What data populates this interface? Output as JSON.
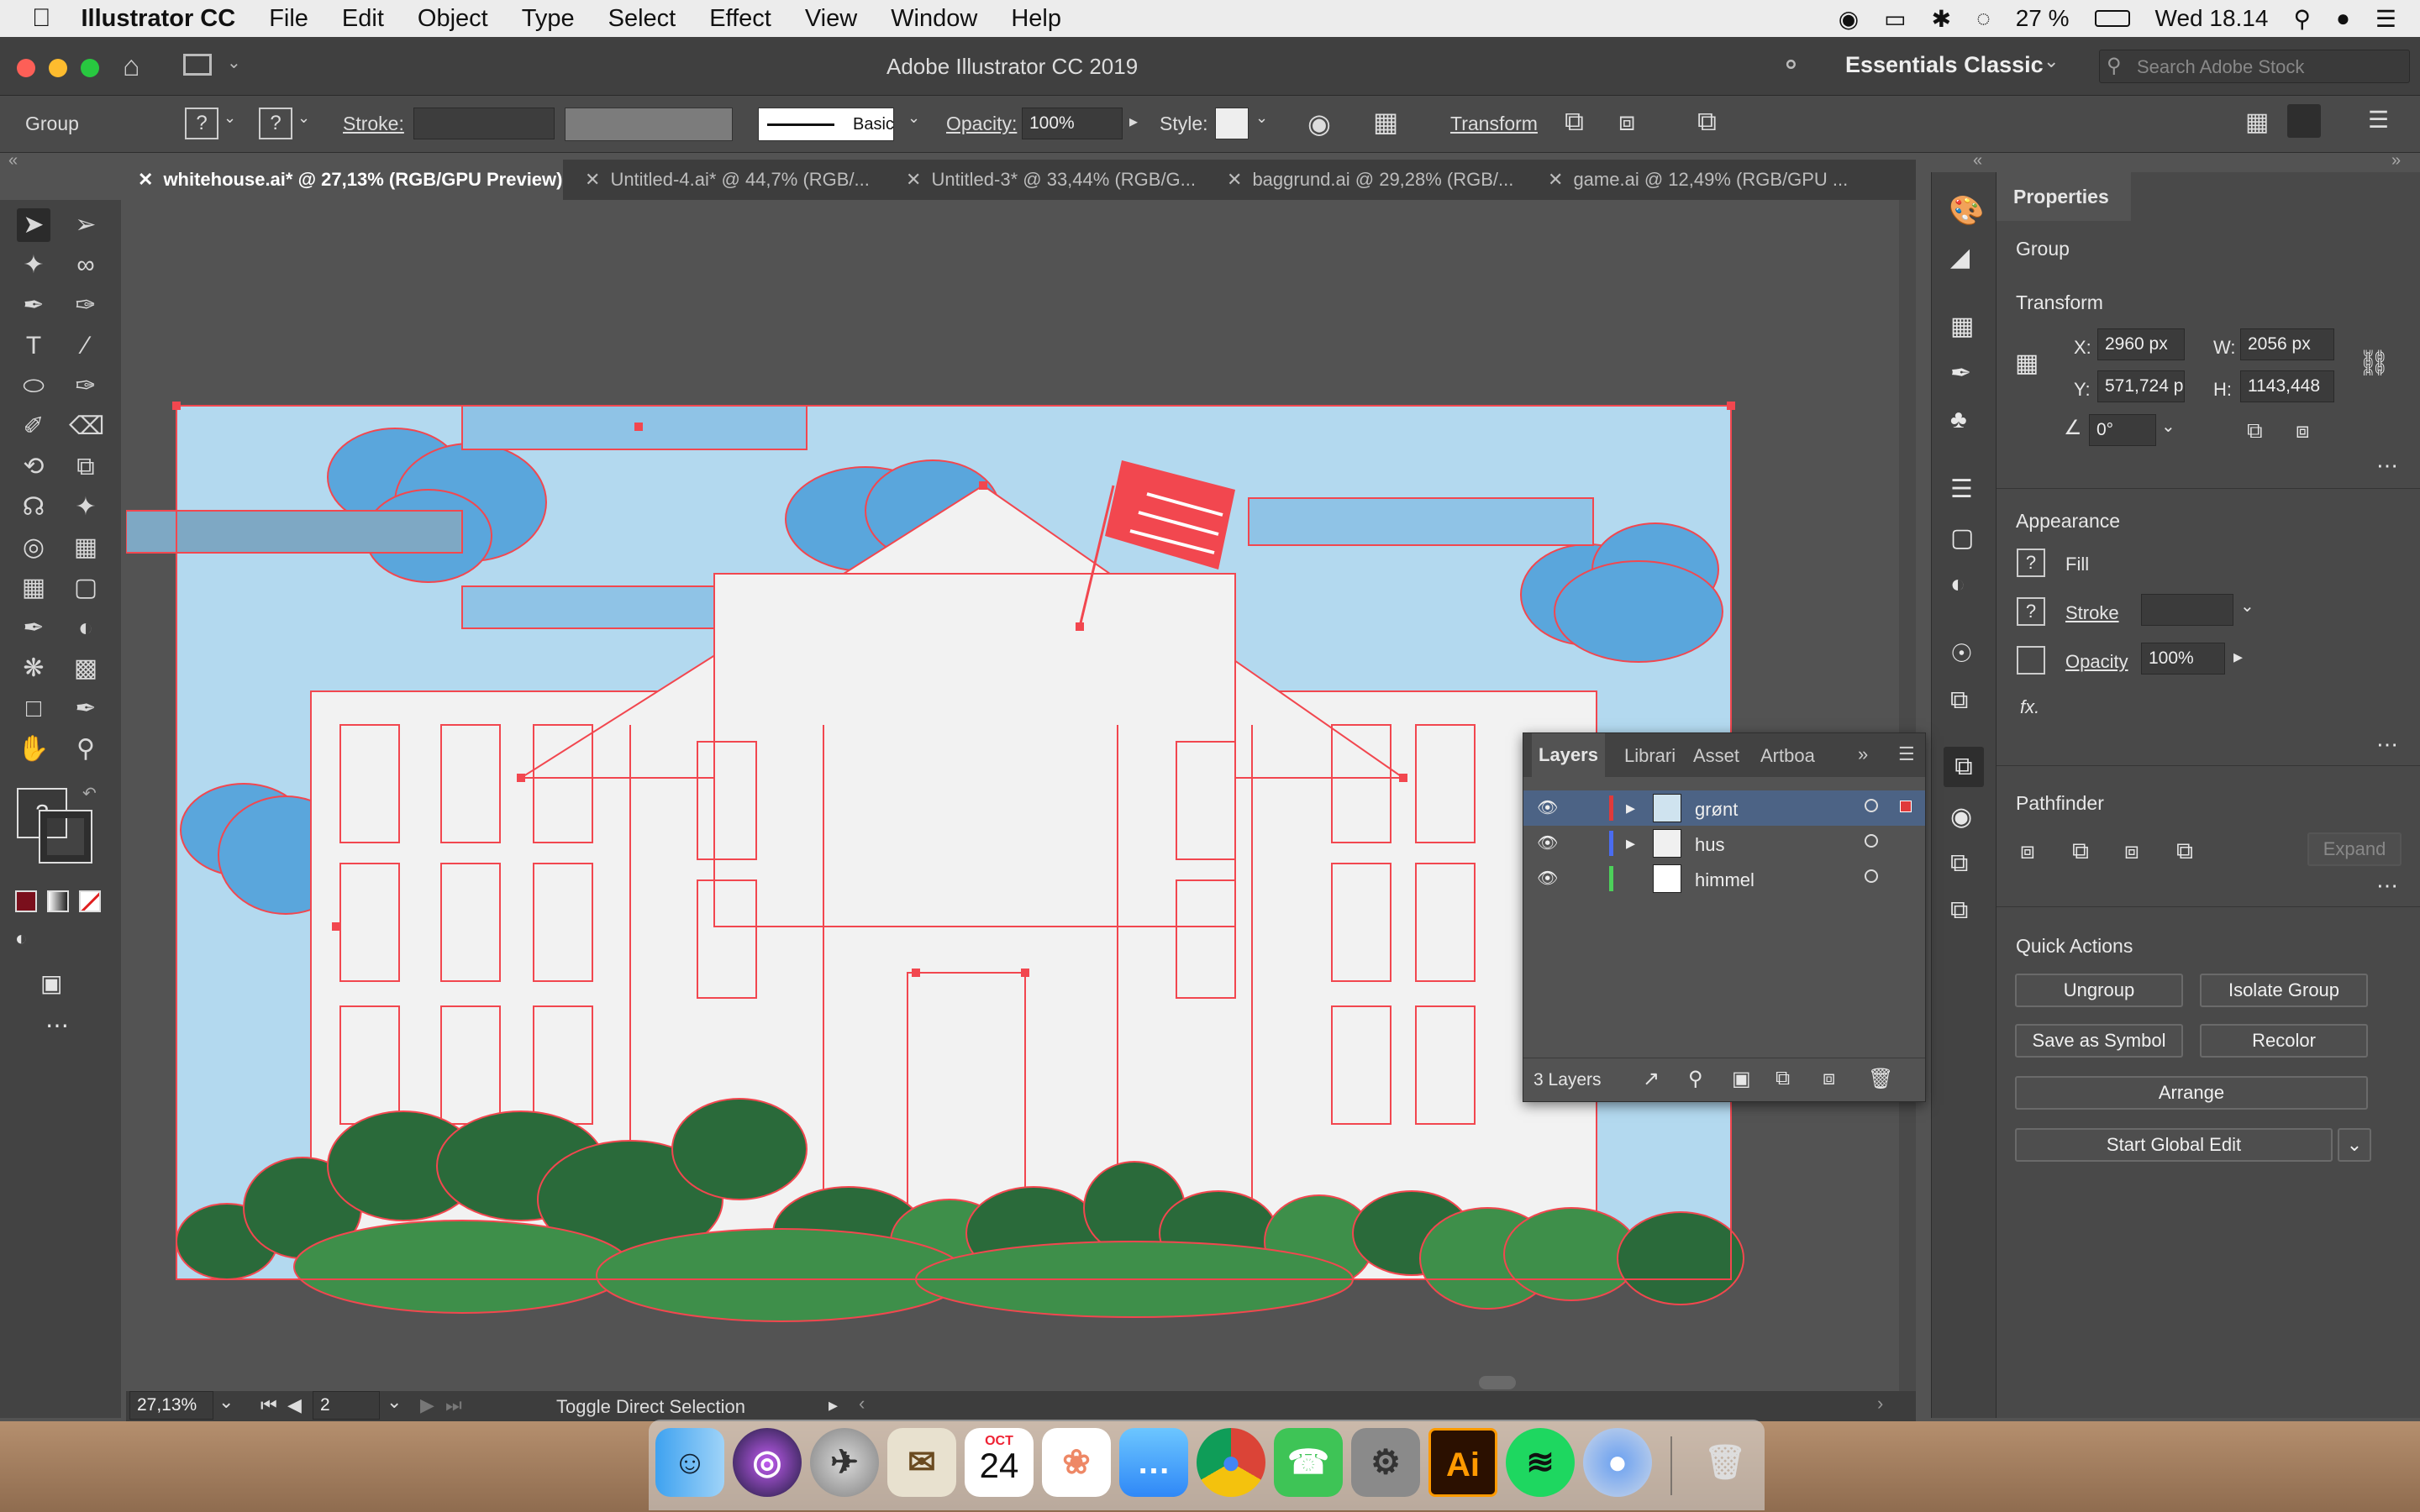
{
  "menubar": {
    "app_name": "Illustrator CC",
    "items": [
      "File",
      "Edit",
      "Object",
      "Type",
      "Select",
      "Effect",
      "View",
      "Window",
      "Help"
    ],
    "battery": "27 %",
    "clock": "Wed 18.14"
  },
  "titlebar": {
    "title": "Adobe Illustrator CC 2019",
    "workspace": "Essentials Classic",
    "search_placeholder": "Search Adobe Stock"
  },
  "control_bar": {
    "selection": "Group",
    "stroke_label": "Stroke:",
    "brush": "Basic",
    "opacity_label": "Opacity:",
    "opacity_value": "100%",
    "style_label": "Style:",
    "transform_label": "Transform"
  },
  "tabs": [
    {
      "label": "whitehouse.ai* @ 27,13% (RGB/GPU Preview)"
    },
    {
      "label": "Untitled-4.ai* @ 44,7% (RGB/..."
    },
    {
      "label": "Untitled-3* @ 33,44% (RGB/G..."
    },
    {
      "label": "baggrund.ai @ 29,28% (RGB/..."
    },
    {
      "label": "game.ai @ 12,49% (RGB/GPU ..."
    }
  ],
  "status": {
    "zoom": "27,13%",
    "artboard": "2",
    "message": "Toggle Direct Selection"
  },
  "properties": {
    "tab": "Properties",
    "kind": "Group",
    "transform_title": "Transform",
    "x_label": "X:",
    "x": "2960 px",
    "y_label": "Y:",
    "y": "571,724 p",
    "w_label": "W:",
    "w": "2056 px",
    "h_label": "H:",
    "h": "1143,448",
    "angle": "0°",
    "appearance_title": "Appearance",
    "fill_label": "Fill",
    "stroke_label": "Stroke",
    "opacity_label": "Opacity",
    "opacity_value": "100%",
    "fx_label": "fx.",
    "pathfinder_title": "Pathfinder",
    "expand_label": "Expand",
    "quick_actions_title": "Quick Actions",
    "ungroup": "Ungroup",
    "isolate": "Isolate Group",
    "save_symbol": "Save as Symbol",
    "recolor": "Recolor",
    "arrange": "Arrange",
    "global_edit": "Start Global Edit"
  },
  "layers_panel": {
    "tabs": [
      "Layers",
      "Librari",
      "Asset",
      "Artboa"
    ],
    "rows": [
      {
        "name": "grønt",
        "color": "#e03a3a"
      },
      {
        "name": "hus",
        "color": "#4a6cf0"
      },
      {
        "name": "himmel",
        "color": "#4cd05a"
      }
    ],
    "count": "3 Layers"
  },
  "dock": {
    "calendar_month": "OCT",
    "calendar_day": "24",
    "ai_label": "Ai"
  },
  "colors": {
    "selection": "#f2474f",
    "sky": "#b3d9ef",
    "cloud": "#5aa6dc",
    "house": "#f2f2f2",
    "bush_dark": "#2a6a3a",
    "bush_light": "#3e8f4a"
  }
}
